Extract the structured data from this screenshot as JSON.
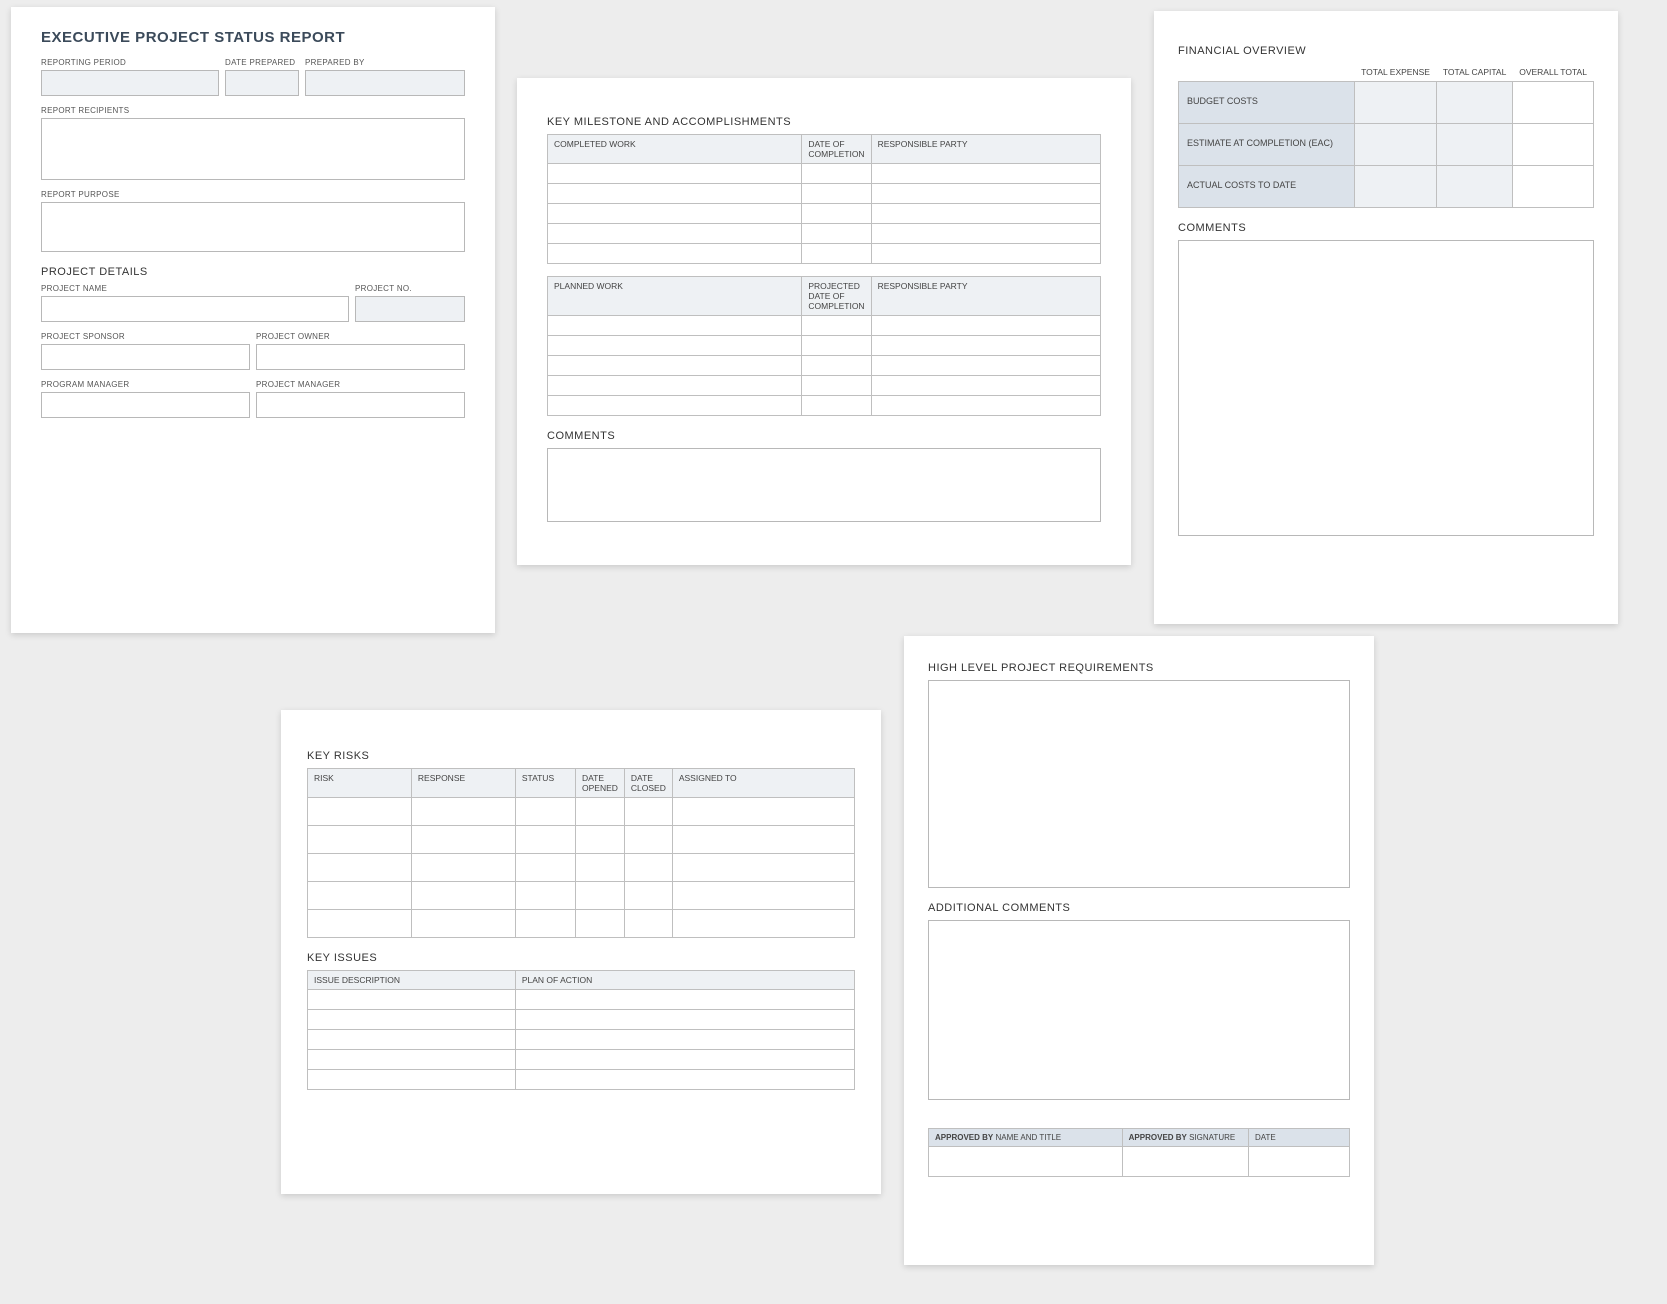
{
  "p1": {
    "title": "EXECUTIVE PROJECT STATUS REPORT",
    "reporting_period_label": "REPORTING PERIOD",
    "date_prepared_label": "DATE PREPARED",
    "prepared_by_label": "PREPARED BY",
    "report_recipients_label": "REPORT RECIPIENTS",
    "report_purpose_label": "REPORT PURPOSE",
    "project_details_title": "PROJECT DETAILS",
    "project_name_label": "PROJECT NAME",
    "project_no_label": "PROJECT NO.",
    "project_sponsor_label": "PROJECT SPONSOR",
    "project_owner_label": "PROJECT OWNER",
    "program_manager_label": "PROGRAM MANAGER",
    "project_manager_label": "PROJECT MANAGER",
    "reporting_period": "",
    "date_prepared": "",
    "prepared_by": "",
    "report_recipients": "",
    "report_purpose": "",
    "project_name": "",
    "project_no": "",
    "project_sponsor": "",
    "project_owner": "",
    "program_manager": "",
    "project_manager": ""
  },
  "p2": {
    "title": "KEY MILESTONE AND ACCOMPLISHMENTS",
    "completed_work_header": "COMPLETED WORK",
    "date_completion_header": "DATE OF COMPLETION",
    "responsible_party_header": "RESPONSIBLE PARTY",
    "planned_work_header": "PLANNED WORK",
    "projected_date_header": "PROJECTED DATE OF COMPLETION",
    "comments_title": "COMMENTS",
    "completed_rows": [
      {
        "work": "",
        "date": "",
        "party": ""
      },
      {
        "work": "",
        "date": "",
        "party": ""
      },
      {
        "work": "",
        "date": "",
        "party": ""
      },
      {
        "work": "",
        "date": "",
        "party": ""
      },
      {
        "work": "",
        "date": "",
        "party": ""
      }
    ],
    "planned_rows": [
      {
        "work": "",
        "date": "",
        "party": ""
      },
      {
        "work": "",
        "date": "",
        "party": ""
      },
      {
        "work": "",
        "date": "",
        "party": ""
      },
      {
        "work": "",
        "date": "",
        "party": ""
      },
      {
        "work": "",
        "date": "",
        "party": ""
      }
    ],
    "comments": ""
  },
  "p3": {
    "title": "FINANCIAL OVERVIEW",
    "total_expense_header": "TOTAL EXPENSE",
    "total_capital_header": "TOTAL CAPITAL",
    "overall_total_header": "OVERALL TOTAL",
    "budget_costs_label": "BUDGET COSTS",
    "eac_label": "ESTIMATE AT COMPLETION (EAC)",
    "actual_costs_label": "ACTUAL COSTS TO DATE",
    "comments_title": "COMMENTS",
    "rows": {
      "budget": {
        "expense": "",
        "capital": "",
        "total": ""
      },
      "eac": {
        "expense": "",
        "capital": "",
        "total": ""
      },
      "actual": {
        "expense": "",
        "capital": "",
        "total": ""
      }
    },
    "comments": ""
  },
  "p4": {
    "risks_title": "KEY RISKS",
    "risk_header": "RISK",
    "response_header": "RESPONSE",
    "status_header": "STATUS",
    "date_opened_header": "DATE OPENED",
    "date_closed_header": "DATE CLOSED",
    "assigned_to_header": "ASSIGNED TO",
    "issues_title": "KEY ISSUES",
    "issue_desc_header": "ISSUE DESCRIPTION",
    "plan_action_header": "PLAN OF ACTION",
    "risk_rows": [
      {
        "risk": "",
        "response": "",
        "status": "",
        "opened": "",
        "closed": "",
        "assigned": ""
      },
      {
        "risk": "",
        "response": "",
        "status": "",
        "opened": "",
        "closed": "",
        "assigned": ""
      },
      {
        "risk": "",
        "response": "",
        "status": "",
        "opened": "",
        "closed": "",
        "assigned": ""
      },
      {
        "risk": "",
        "response": "",
        "status": "",
        "opened": "",
        "closed": "",
        "assigned": ""
      },
      {
        "risk": "",
        "response": "",
        "status": "",
        "opened": "",
        "closed": "",
        "assigned": ""
      }
    ],
    "issue_rows": [
      {
        "desc": "",
        "plan": ""
      },
      {
        "desc": "",
        "plan": ""
      },
      {
        "desc": "",
        "plan": ""
      },
      {
        "desc": "",
        "plan": ""
      },
      {
        "desc": "",
        "plan": ""
      }
    ]
  },
  "p5": {
    "requirements_title": "HIGH LEVEL PROJECT REQUIREMENTS",
    "additional_comments_title": "ADDITIONAL COMMENTS",
    "approved_by_name_label": "APPROVED BY NAME AND TITLE",
    "approved_by_sig_label": "APPROVED BY SIGNATURE",
    "date_label": "DATE",
    "requirements": "",
    "additional_comments": "",
    "approved_name": "",
    "approved_sig": "",
    "approved_date": ""
  }
}
